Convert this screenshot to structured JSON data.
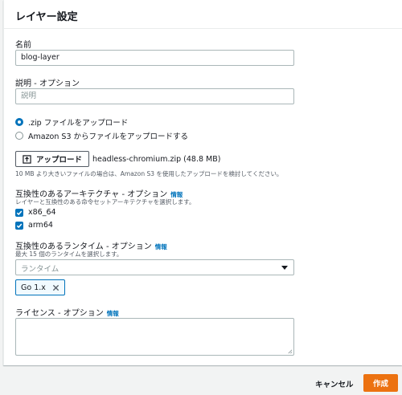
{
  "panel": {
    "title": "レイヤー設定"
  },
  "name": {
    "label": "名前",
    "value": "blog-layer"
  },
  "description": {
    "label": "説明 - オプション",
    "placeholder": "説明"
  },
  "upload_source": {
    "options": [
      {
        "label": ".zip ファイルをアップロード",
        "selected": true
      },
      {
        "label": "Amazon S3 からファイルをアップロードする",
        "selected": false
      }
    ]
  },
  "upload": {
    "button_label": "アップロード",
    "file_name": "headless-chromium.zip (48.8 MB)",
    "hint": "10 MB より大きいファイルの場合は、Amazon S3 を使用したアップロードを検討してください。"
  },
  "architectures": {
    "label": "互換性のあるアーキテクチャ - オプション",
    "info": "情報",
    "hint": "レイヤーと互換性のある命令セットアーキテクチャを選択します。",
    "options": [
      {
        "label": "x86_64",
        "checked": true
      },
      {
        "label": "arm64",
        "checked": true
      }
    ]
  },
  "runtimes": {
    "label": "互換性のあるランタイム - オプション",
    "info": "情報",
    "hint": "最大 15 個のランタイムを選択します。",
    "placeholder": "ランタイム",
    "selected_tokens": [
      "Go 1.x"
    ]
  },
  "license": {
    "label": "ライセンス - オプション",
    "info": "情報",
    "value": ""
  },
  "footer": {
    "cancel_label": "キャンセル",
    "create_label": "作成"
  },
  "colors": {
    "accent": "#0073bb",
    "primary_button": "#ec7211",
    "background": "#f2f3f3"
  }
}
